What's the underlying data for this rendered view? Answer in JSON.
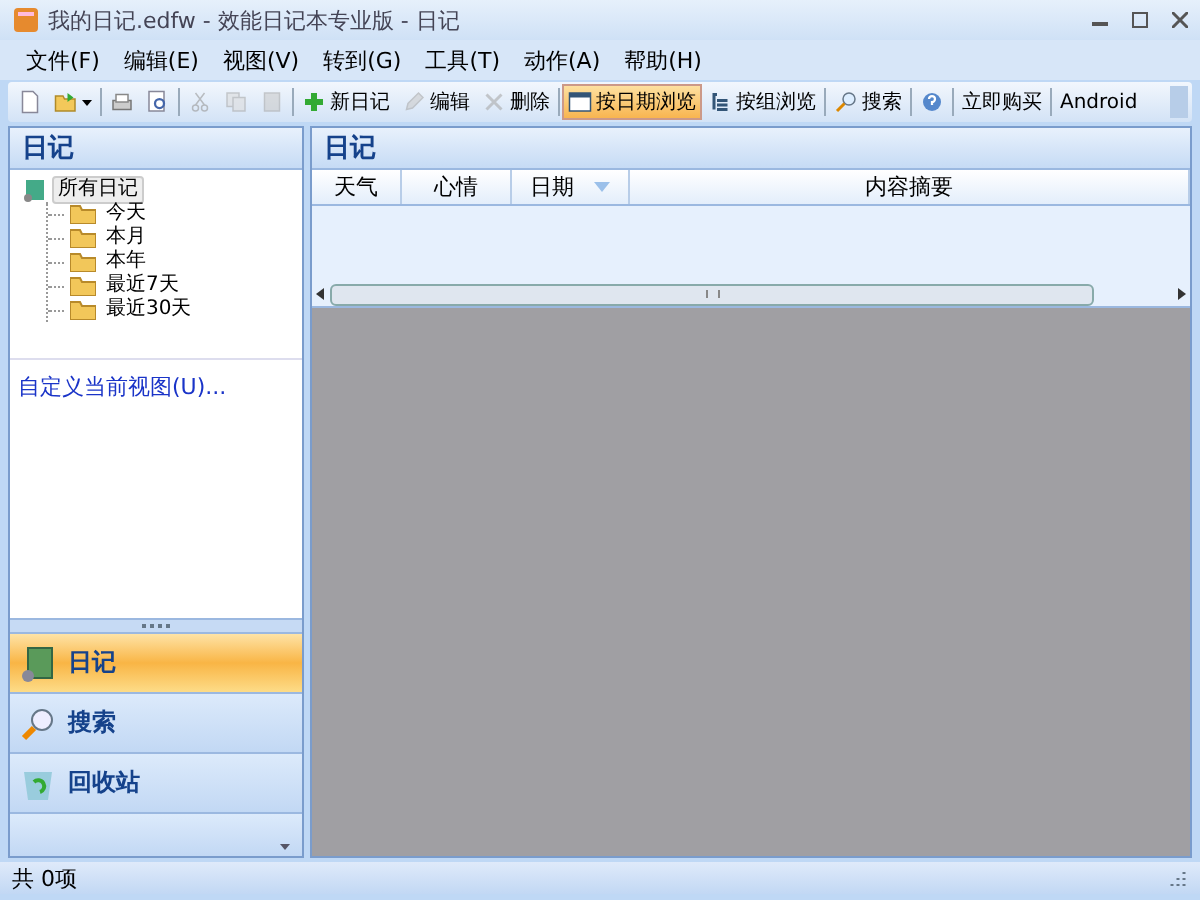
{
  "window": {
    "title": "我的日记.edfw - 效能日记本专业版 - 日记"
  },
  "menu": [
    "文件(F)",
    "编辑(E)",
    "视图(V)",
    "转到(G)",
    "工具(T)",
    "动作(A)",
    "帮助(H)"
  ],
  "toolbar": [
    {
      "kind": "icon",
      "disabled": false,
      "selected": false
    },
    {
      "kind": "dropdown",
      "disabled": false,
      "selected": false
    },
    {
      "kind": "sep"
    },
    {
      "kind": "icon",
      "disabled": false,
      "selected": false
    },
    {
      "kind": "icon",
      "disabled": false,
      "selected": false
    },
    {
      "kind": "sep"
    },
    {
      "kind": "icon",
      "disabled": true,
      "selected": false
    },
    {
      "kind": "icon",
      "disabled": true,
      "selected": false
    },
    {
      "kind": "icon",
      "disabled": true,
      "selected": false
    },
    {
      "kind": "sep"
    },
    {
      "kind": "button",
      "label": "新日记",
      "disabled": false,
      "selected": false
    },
    {
      "kind": "button",
      "label": "编辑",
      "disabled": true,
      "selected": false
    },
    {
      "kind": "button",
      "label": "删除",
      "disabled": true,
      "selected": false
    },
    {
      "kind": "sep"
    },
    {
      "kind": "button",
      "label": "按日期浏览",
      "disabled": false,
      "selected": true
    },
    {
      "kind": "button",
      "label": "按组浏览",
      "disabled": false,
      "selected": false
    },
    {
      "kind": "sep"
    },
    {
      "kind": "button",
      "label": "搜索",
      "disabled": false,
      "selected": false
    },
    {
      "kind": "sep"
    },
    {
      "kind": "icon",
      "disabled": false,
      "selected": false
    },
    {
      "kind": "sep"
    },
    {
      "kind": "button",
      "label": "立即购买"
    },
    {
      "kind": "sep"
    },
    {
      "kind": "text",
      "label": "Android"
    }
  ],
  "sidebar": {
    "title": "日记",
    "tree": [
      {
        "label": "所有日记",
        "selected": true,
        "children": [
          {
            "label": "今天",
            "selected": false
          },
          {
            "label": "本月",
            "selected": false
          },
          {
            "label": "本年",
            "selected": false
          },
          {
            "label": "最近7天",
            "selected": false
          },
          {
            "label": "最近30天",
            "selected": false
          }
        ]
      }
    ],
    "link": "自定义当前视图(U)...",
    "nav": [
      {
        "label": "日记",
        "selected": true
      },
      {
        "label": "搜索",
        "selected": false
      },
      {
        "label": "回收站",
        "selected": false
      }
    ]
  },
  "main": {
    "title": "日记",
    "columns": [
      {
        "label": "天气",
        "sorted": false
      },
      {
        "label": "心情",
        "sorted": false
      },
      {
        "label": "日期",
        "sorted": true
      },
      {
        "label": "内容摘要",
        "sorted": false
      }
    ]
  },
  "status_bar": "共 0项"
}
